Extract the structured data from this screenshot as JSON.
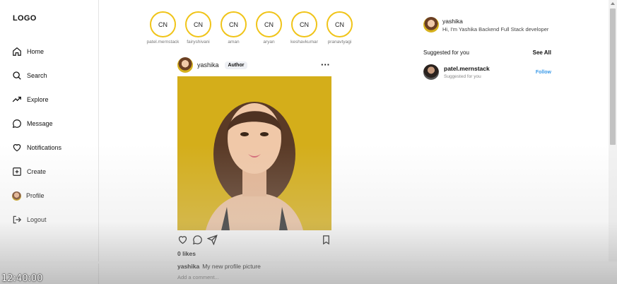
{
  "sidebar": {
    "logo": "LOGO",
    "items": [
      {
        "label": "Home",
        "icon": "home-icon"
      },
      {
        "label": "Search",
        "icon": "search-icon"
      },
      {
        "label": "Explore",
        "icon": "trending-up-icon"
      },
      {
        "label": "Message",
        "icon": "message-icon"
      },
      {
        "label": "Notifications",
        "icon": "heart-icon"
      },
      {
        "label": "Create",
        "icon": "plus-square-icon"
      },
      {
        "label": "Profile",
        "icon": "avatar"
      },
      {
        "label": "Logout",
        "icon": "logout-icon"
      }
    ]
  },
  "stories": [
    {
      "initials": "CN",
      "name": "patel.mernstack"
    },
    {
      "initials": "CN",
      "name": "fairyshivani"
    },
    {
      "initials": "CN",
      "name": "aman"
    },
    {
      "initials": "CN",
      "name": "aryan"
    },
    {
      "initials": "CN",
      "name": "keshavkumar"
    },
    {
      "initials": "CN",
      "name": "pranavtyagi"
    }
  ],
  "post": {
    "username": "yashika",
    "badge": "Author",
    "likes": "0 likes",
    "caption_user": "yashika",
    "caption_text": "My new profile picture",
    "comment_placeholder": "Add a comment..."
  },
  "profile": {
    "username": "yashika",
    "bio": "Hi, I'm Yashika Backend Full Stack developer"
  },
  "suggestions": {
    "title": "Suggested for you",
    "see_all": "See All",
    "items": [
      {
        "name": "patel.mernstack",
        "subtitle": "Suggested for you",
        "action": "Follow"
      }
    ]
  },
  "overlay": {
    "clock": "12:40:00"
  },
  "colors": {
    "story_ring": "#f0c419",
    "follow": "#3b9ae8",
    "photo_bg": "#d7b21b"
  }
}
